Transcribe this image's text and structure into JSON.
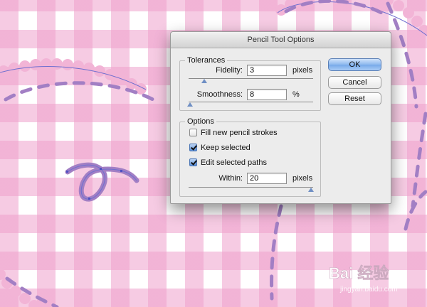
{
  "dialog": {
    "title": "Pencil Tool Options"
  },
  "tolerances": {
    "label": "Tolerances",
    "fidelity": {
      "label": "Fidelity:",
      "value": "3",
      "unit": "pixels"
    },
    "smoothness": {
      "label": "Smoothness:",
      "value": "8",
      "unit": "%"
    }
  },
  "options": {
    "label": "Options",
    "fill_new": {
      "label": "Fill new pencil strokes",
      "checked": false
    },
    "keep_selected": {
      "label": "Keep selected",
      "checked": true
    },
    "edit_selected": {
      "label": "Edit selected paths",
      "checked": true
    },
    "within": {
      "label": "Within:",
      "value": "20",
      "unit": "pixels"
    }
  },
  "buttons": {
    "ok": "OK",
    "cancel": "Cancel",
    "reset": "Reset"
  },
  "watermark": {
    "text": "Bai 经验",
    "sub": "jingyan.baidu.com"
  },
  "colors": {
    "stitch": "#a27fc4",
    "scallop": "#f2b4d6",
    "path": "#6f6fd0",
    "accent": "#76a9e9"
  }
}
